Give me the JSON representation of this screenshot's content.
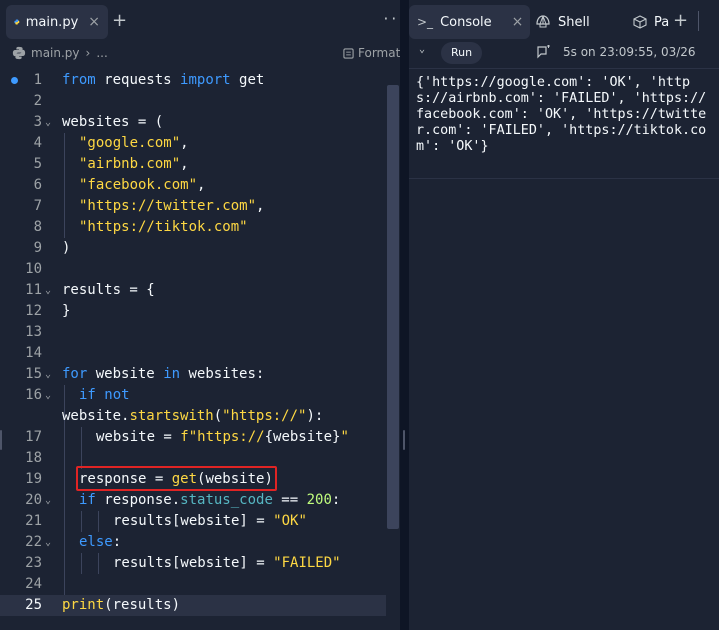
{
  "left_tabs": {
    "file_tab": "main.py",
    "close_glyph": "×",
    "plus_glyph": "+",
    "more_glyph": "···"
  },
  "breadcrumb": {
    "file": "main.py",
    "sep": "›",
    "rest": "...",
    "format_label": "Format"
  },
  "editor": {
    "current_line": 25,
    "lines": [
      {
        "n": "1",
        "fold": false
      },
      {
        "n": "2",
        "fold": false
      },
      {
        "n": "3",
        "fold": true
      },
      {
        "n": "4",
        "fold": false
      },
      {
        "n": "5",
        "fold": false
      },
      {
        "n": "6",
        "fold": false
      },
      {
        "n": "7",
        "fold": false
      },
      {
        "n": "8",
        "fold": false
      },
      {
        "n": "9",
        "fold": false
      },
      {
        "n": "10",
        "fold": false
      },
      {
        "n": "11",
        "fold": true
      },
      {
        "n": "12",
        "fold": false
      },
      {
        "n": "13",
        "fold": false
      },
      {
        "n": "14",
        "fold": false
      },
      {
        "n": "15",
        "fold": true
      },
      {
        "n": "16",
        "fold": true
      },
      {
        "n": "",
        "fold": false
      },
      {
        "n": "17",
        "fold": false
      },
      {
        "n": "18",
        "fold": false
      },
      {
        "n": "19",
        "fold": false
      },
      {
        "n": "20",
        "fold": true
      },
      {
        "n": "21",
        "fold": false
      },
      {
        "n": "22",
        "fold": true
      },
      {
        "n": "23",
        "fold": false
      },
      {
        "n": "24",
        "fold": false
      },
      {
        "n": "25",
        "fold": false
      }
    ],
    "tokens": {
      "l1": [
        "from",
        "requests",
        "import",
        "get"
      ],
      "l3": [
        "websites = ("
      ],
      "l4": [
        "\"google.com\"",
        ","
      ],
      "l5": [
        "\"airbnb.com\"",
        ","
      ],
      "l6": [
        "\"facebook.com\"",
        ","
      ],
      "l7": [
        "\"https://twitter.com\"",
        ","
      ],
      "l8": [
        "\"https://tiktok.com\""
      ],
      "l9": [
        ")"
      ],
      "l11": [
        "results = {"
      ],
      "l12": [
        "}"
      ],
      "l15": [
        "for",
        "website",
        "in",
        "websites:"
      ],
      "l16": [
        "if",
        "not"
      ],
      "l16b": [
        "website.",
        "startswith",
        "(",
        "\"https://\"",
        "):"
      ],
      "l17": [
        "website = ",
        "f\"https://",
        "{website}",
        "\""
      ],
      "l19": [
        "response = ",
        "get",
        "(website)"
      ],
      "l20": [
        "if",
        " response.",
        "status_code",
        " == ",
        "200",
        ":"
      ],
      "l21": [
        "results[website] = ",
        "\"OK\""
      ],
      "l22": [
        "else",
        ":"
      ],
      "l23": [
        "results[website] = ",
        "\"FAILED\""
      ],
      "l25": [
        "print",
        "(results)"
      ]
    }
  },
  "right_tabs": {
    "console": "Console",
    "shell": "Shell",
    "packages": "Pa",
    "plus_glyph": "+"
  },
  "console": {
    "run_label": "Run",
    "meta": "5s on 23:09:55, 03/26",
    "output": "{'https://google.com': 'OK', 'https://airbnb.com': 'FAILED', 'https://facebook.com': 'OK', 'https://twitter.com': 'FAILED', 'https://tiktok.com': 'OK'}"
  },
  "colors": {
    "highlight_box": "#e02424",
    "keyword": "#3e9aff",
    "string": "#fed843",
    "number": "#bffc7d"
  }
}
